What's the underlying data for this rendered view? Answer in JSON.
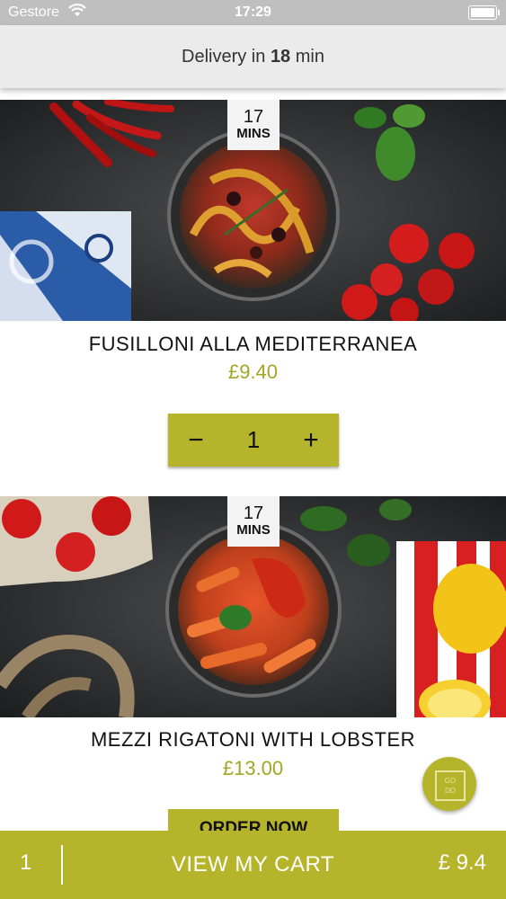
{
  "status_bar": {
    "carrier": "Gestore",
    "time": "17:29"
  },
  "header": {
    "delivery_prefix": "Delivery in",
    "delivery_minutes": "18",
    "delivery_suffix": "min"
  },
  "products": [
    {
      "name": "FUSILLONI ALLA MEDITERRANEA",
      "price": "£9.40",
      "prep_time": "17",
      "prep_unit": "MINS",
      "quantity": "1"
    },
    {
      "name": "MEZZI RIGATONI WITH LOBSTER",
      "price": "£13.00",
      "prep_time": "17",
      "prep_unit": "MINS",
      "order_label": "ORDER NOW"
    }
  ],
  "stepper": {
    "minus": "−",
    "plus": "+"
  },
  "chat_fab": {
    "line1": "GO",
    "line2": "DO"
  },
  "cart_bar": {
    "count": "1",
    "label": "VIEW MY CART",
    "total": "£ 9.4"
  },
  "colors": {
    "accent": "#b5b42b",
    "price": "#a3a526",
    "header_bg": "#ebebeb",
    "status_bg": "#bfbfbf"
  }
}
